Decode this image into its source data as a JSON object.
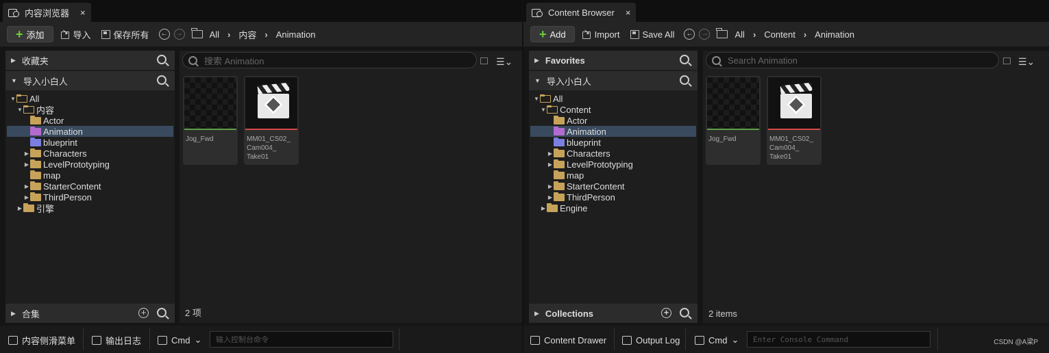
{
  "left": {
    "tab_title": "内容浏览器",
    "close": "×",
    "add_label": "添加",
    "import_label": "导入",
    "save_all_label": "保存所有",
    "breadcrumb": [
      "All",
      "内容",
      "Animation"
    ],
    "favorites_label": "收藏夹",
    "project_label": "导入小白人",
    "tree": [
      {
        "label": "All",
        "level": 0,
        "expanded": true,
        "selected": false,
        "icon": "folder-open"
      },
      {
        "label": "内容",
        "level": 1,
        "expanded": true,
        "selected": false,
        "icon": "folder-open"
      },
      {
        "label": "Actor",
        "level": 2,
        "expanded": null,
        "selected": false,
        "icon": "folder"
      },
      {
        "label": "Animation",
        "level": 2,
        "expanded": null,
        "selected": true,
        "icon": "folder-purple"
      },
      {
        "label": "blueprint",
        "level": 2,
        "expanded": null,
        "selected": false,
        "icon": "folder-blue"
      },
      {
        "label": "Characters",
        "level": 2,
        "expanded": false,
        "selected": false,
        "icon": "folder"
      },
      {
        "label": "LevelPrototyping",
        "level": 2,
        "expanded": false,
        "selected": false,
        "icon": "folder"
      },
      {
        "label": "map",
        "level": 2,
        "expanded": null,
        "selected": false,
        "icon": "folder"
      },
      {
        "label": "StarterContent",
        "level": 2,
        "expanded": false,
        "selected": false,
        "icon": "folder"
      },
      {
        "label": "ThirdPerson",
        "level": 2,
        "expanded": false,
        "selected": false,
        "icon": "folder"
      },
      {
        "label": "引擎",
        "level": 1,
        "expanded": false,
        "selected": false,
        "icon": "folder"
      }
    ],
    "collections_label": "合集",
    "search_placeholder": "搜索 Animation",
    "assets": [
      {
        "name": "Jog_Fwd",
        "type": "animation",
        "bar_color": "#5fa04a"
      },
      {
        "name": "MM01_CS02_\nCam004_\nTake01",
        "type": "sequence",
        "bar_color": "#d24a4a"
      }
    ],
    "item_count": "2 项",
    "drawer_label": "内容侧滑菜单",
    "output_log_label": "输出日志",
    "cmd_label": "Cmd",
    "console_placeholder": "输入控制台命令"
  },
  "right": {
    "tab_title": "Content Browser",
    "close": "×",
    "add_label": "Add",
    "import_label": "Import",
    "save_all_label": "Save All",
    "breadcrumb": [
      "All",
      "Content",
      "Animation"
    ],
    "favorites_label": "Favorites",
    "project_label": "导入小白人",
    "tree": [
      {
        "label": "All",
        "level": 0,
        "expanded": true,
        "selected": false,
        "icon": "folder-open"
      },
      {
        "label": "Content",
        "level": 1,
        "expanded": true,
        "selected": false,
        "icon": "folder-open"
      },
      {
        "label": "Actor",
        "level": 2,
        "expanded": null,
        "selected": false,
        "icon": "folder"
      },
      {
        "label": "Animation",
        "level": 2,
        "expanded": null,
        "selected": true,
        "icon": "folder-purple"
      },
      {
        "label": "blueprint",
        "level": 2,
        "expanded": null,
        "selected": false,
        "icon": "folder-blue"
      },
      {
        "label": "Characters",
        "level": 2,
        "expanded": false,
        "selected": false,
        "icon": "folder"
      },
      {
        "label": "LevelPrototyping",
        "level": 2,
        "expanded": false,
        "selected": false,
        "icon": "folder"
      },
      {
        "label": "map",
        "level": 2,
        "expanded": null,
        "selected": false,
        "icon": "folder"
      },
      {
        "label": "StarterContent",
        "level": 2,
        "expanded": false,
        "selected": false,
        "icon": "folder"
      },
      {
        "label": "ThirdPerson",
        "level": 2,
        "expanded": false,
        "selected": false,
        "icon": "folder"
      },
      {
        "label": "Engine",
        "level": 1,
        "expanded": false,
        "selected": false,
        "icon": "folder"
      }
    ],
    "collections_label": "Collections",
    "search_placeholder": "Search Animation",
    "assets": [
      {
        "name": "Jog_Fwd",
        "type": "animation",
        "bar_color": "#5fa04a"
      },
      {
        "name": "MM01_CS02_\nCam004_\nTake01",
        "type": "sequence",
        "bar_color": "#d24a4a"
      }
    ],
    "item_count": "2 items",
    "drawer_label": "Content Drawer",
    "output_log_label": "Output Log",
    "cmd_label": "Cmd",
    "console_placeholder": "Enter Console Command"
  },
  "watermark": "CSDN @A梁P"
}
